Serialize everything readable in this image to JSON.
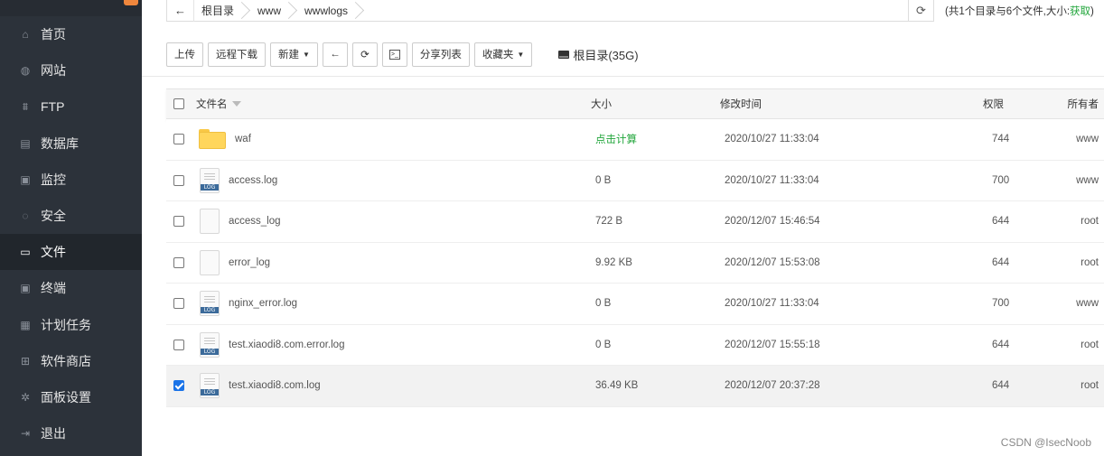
{
  "sidebar": {
    "items": [
      {
        "label": "首页",
        "icon": "home-icon",
        "glyph": "⌂"
      },
      {
        "label": "网站",
        "icon": "globe-icon",
        "glyph": "◍"
      },
      {
        "label": "FTP",
        "icon": "ftp-icon",
        "glyph": "⩩"
      },
      {
        "label": "数据库",
        "icon": "database-icon",
        "glyph": "▤"
      },
      {
        "label": "监控",
        "icon": "monitor-icon",
        "glyph": "▣"
      },
      {
        "label": "安全",
        "icon": "shield-icon",
        "glyph": "◌"
      },
      {
        "label": "文件",
        "icon": "folder-icon",
        "glyph": "▭"
      },
      {
        "label": "终端",
        "icon": "terminal-icon",
        "glyph": "▣"
      },
      {
        "label": "计划任务",
        "icon": "calendar-icon",
        "glyph": "▦"
      },
      {
        "label": "软件商店",
        "icon": "apps-icon",
        "glyph": "⊞"
      },
      {
        "label": "面板设置",
        "icon": "gear-icon",
        "glyph": "✲"
      },
      {
        "label": "退出",
        "icon": "logout-icon",
        "glyph": "⇥"
      }
    ],
    "active_index": 6
  },
  "breadcrumb": {
    "back_glyph": "←",
    "items": [
      "根目录",
      "www",
      "wwwlogs"
    ]
  },
  "dirinfo": {
    "text": "(共1个目录与6个文件,大小:",
    "link": "获取",
    "close": ")"
  },
  "toolbar": {
    "upload": "上传",
    "remote_download": "远程下载",
    "new": "新建",
    "share_list": "分享列表",
    "favorites": "收藏夹",
    "disk_label": "根目录(35G)"
  },
  "table": {
    "headers": {
      "name": "文件名",
      "size": "大小",
      "mtime": "修改时间",
      "perm": "权限",
      "owner": "所有者"
    },
    "rows": [
      {
        "type": "folder",
        "name": "waf",
        "size": "点击计算",
        "mtime": "2020/10/27 11:33:04",
        "perm": "744",
        "owner": "www",
        "checked": false
      },
      {
        "type": "log",
        "name": "access.log",
        "size": "0 B",
        "mtime": "2020/10/27 11:33:04",
        "perm": "700",
        "owner": "www",
        "checked": false
      },
      {
        "type": "file",
        "name": "access_log",
        "size": "722 B",
        "mtime": "2020/12/07 15:46:54",
        "perm": "644",
        "owner": "root",
        "checked": false
      },
      {
        "type": "file",
        "name": "error_log",
        "size": "9.92 KB",
        "mtime": "2020/12/07 15:53:08",
        "perm": "644",
        "owner": "root",
        "checked": false
      },
      {
        "type": "log",
        "name": "nginx_error.log",
        "size": "0 B",
        "mtime": "2020/10/27 11:33:04",
        "perm": "700",
        "owner": "www",
        "checked": false
      },
      {
        "type": "log",
        "name": "test.xiaodi8.com.error.log",
        "size": "0 B",
        "mtime": "2020/12/07 15:55:18",
        "perm": "644",
        "owner": "root",
        "checked": false
      },
      {
        "type": "log",
        "name": "test.xiaodi8.com.log",
        "size": "36.49 KB",
        "mtime": "2020/12/07 20:37:28",
        "perm": "644",
        "owner": "root",
        "checked": true
      }
    ]
  },
  "watermark": "CSDN @IsecNoob",
  "colors": {
    "sidebar_bg": "#2c323a",
    "accent_green": "#20a53a",
    "checkbox_blue": "#1a73e8",
    "folder_yellow": "#ffd65c"
  }
}
